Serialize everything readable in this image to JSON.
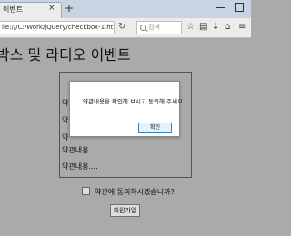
{
  "browser": {
    "tab": {
      "title": "이벤트",
      "close": "×"
    },
    "new_tab": "+",
    "url": "ile:///C:/Work/jQuery/checkbox-1.html",
    "search_placeholder": "검색",
    "icons": {
      "reload": "↻",
      "bookmark": "☆",
      "reading": "▤",
      "download": "↓",
      "home": "⌂",
      "menu": "≡"
    }
  },
  "page": {
    "heading": "박스 및 라디오 이벤트",
    "terms": [
      "약",
      "약",
      "약",
      "약관내용....",
      "약관내용...."
    ],
    "agree_label": "약관에 동의하시겠습니까?",
    "signup_label": "회원가입"
  },
  "dialog": {
    "message": "약관내용을 확인해 보시고 동의해 주세요.",
    "ok_label": "확인"
  }
}
